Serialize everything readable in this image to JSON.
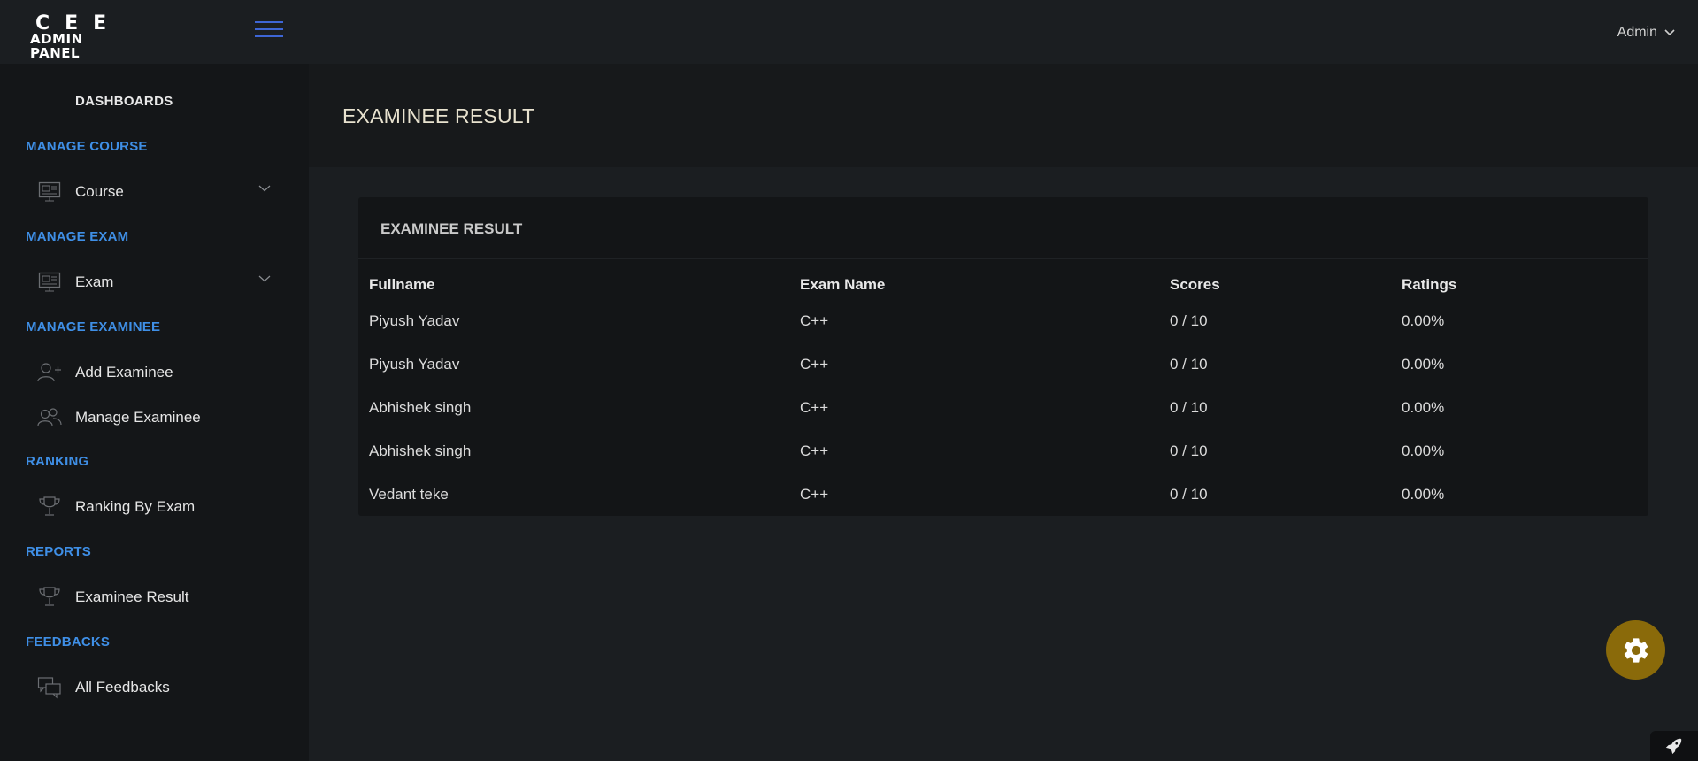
{
  "brand": {
    "line1": "CEE",
    "line2": "ADMIN PANEL"
  },
  "header": {
    "user_label": "Admin"
  },
  "sidebar": {
    "dashboards": "DASHBOARDS",
    "sections": [
      {
        "heading": "MANAGE COURSE",
        "items": [
          {
            "label": "Course",
            "icon": "monitor-icon",
            "has_submenu": true
          }
        ]
      },
      {
        "heading": "MANAGE EXAM",
        "items": [
          {
            "label": "Exam",
            "icon": "monitor-icon",
            "has_submenu": true
          }
        ]
      },
      {
        "heading": "MANAGE EXAMINEE",
        "items": [
          {
            "label": "Add Examinee",
            "icon": "add-user-icon"
          },
          {
            "label": "Manage Examinee",
            "icon": "users-icon"
          }
        ]
      },
      {
        "heading": "RANKING",
        "items": [
          {
            "label": "Ranking By Exam",
            "icon": "trophy-icon"
          }
        ]
      },
      {
        "heading": "REPORTS",
        "items": [
          {
            "label": "Examinee Result",
            "icon": "trophy-icon"
          }
        ]
      },
      {
        "heading": "FEEDBACKS",
        "items": [
          {
            "label": "All Feedbacks",
            "icon": "chat-icon"
          }
        ]
      }
    ]
  },
  "page": {
    "title": "EXAMINEE RESULT"
  },
  "card": {
    "title": "EXAMINEE RESULT",
    "columns": [
      "Fullname",
      "Exam Name",
      "Scores",
      "Ratings"
    ],
    "rows": [
      [
        "Piyush Yadav",
        "C++",
        "0 / 10",
        "0.00%"
      ],
      [
        "Piyush Yadav",
        "C++",
        "0 / 10",
        "0.00%"
      ],
      [
        "Abhishek singh",
        "C++",
        "0 / 10",
        "0.00%"
      ],
      [
        "Abhishek singh",
        "C++",
        "0 / 10",
        "0.00%"
      ],
      [
        "Vedant teke",
        "C++",
        "0 / 10",
        "0.00%"
      ]
    ]
  },
  "colors": {
    "accent": "#3f8fe6",
    "hamburger": "#3e66d6",
    "gear_button": "#8a6a0a"
  },
  "floating": {
    "settings_icon": "gear-icon",
    "corner_icon": "rocket-icon"
  }
}
